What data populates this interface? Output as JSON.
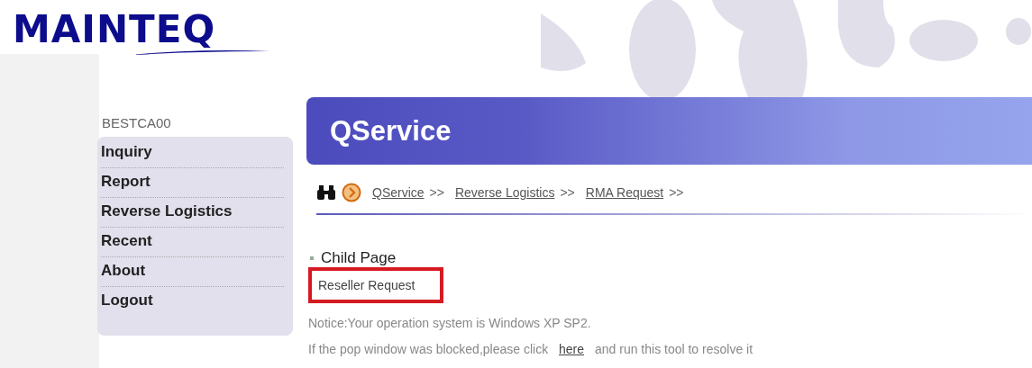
{
  "logo": {
    "text": "MAINTEQ"
  },
  "user": {
    "name": "BESTCA00"
  },
  "sidebar": {
    "items": [
      {
        "label": "Inquiry"
      },
      {
        "label": "Report"
      },
      {
        "label": "Reverse Logistics"
      },
      {
        "label": "Recent"
      },
      {
        "label": "About"
      },
      {
        "label": "Logout"
      }
    ]
  },
  "header": {
    "title": "QService"
  },
  "breadcrumb": [
    {
      "label": "QService",
      "separator": ">>"
    },
    {
      "label": "Reverse Logistics",
      "separator": ">>"
    },
    {
      "label": "RMA Request",
      "separator": ">>"
    }
  ],
  "section": {
    "title": "Child Page",
    "links": [
      {
        "label": "Reseller Request",
        "highlighted": true
      }
    ]
  },
  "notice": {
    "text": "Notice:Your operation system is Windows XP SP2.",
    "before_link": "If the pop window was blocked,please click",
    "link": "here",
    "after_link": "and run this tool to resolve it"
  }
}
